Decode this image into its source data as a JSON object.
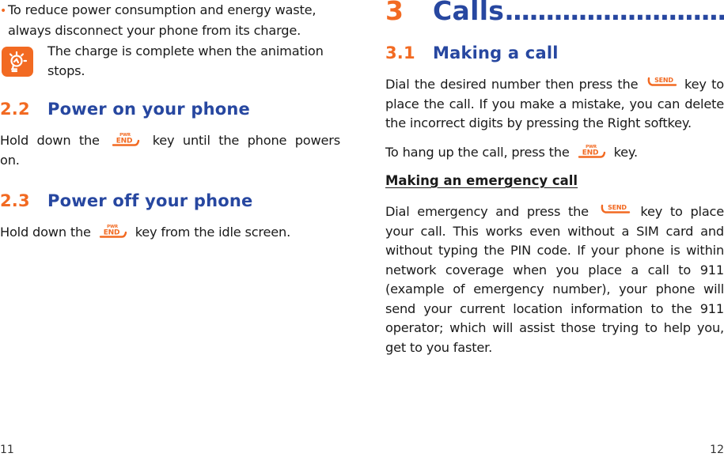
{
  "left_page": {
    "bullet": {
      "line1": "To reduce power consumption and energy waste,",
      "line2": "always disconnect your phone from its charge."
    },
    "tip": {
      "icon": "lightbulb-icon",
      "line1": "The charge is complete when the animation",
      "line2": "stops."
    },
    "section_2_2": {
      "number": "2.2",
      "title": "Power on your phone",
      "text_before": "Hold down the",
      "key": {
        "label": "END",
        "superscript": "PWR",
        "icon": "end-power-key-icon"
      },
      "text_after": "key until the phone powers on."
    },
    "section_2_3": {
      "number": "2.3",
      "title": "Power off your phone",
      "text_before": "Hold down the",
      "key": {
        "label": "END",
        "superscript": "PWR",
        "icon": "end-power-key-icon"
      },
      "text_after": "key from the idle screen."
    },
    "page_number": "11"
  },
  "right_page": {
    "chapter": {
      "number": "3",
      "title": "Calls",
      "leader": "..............................."
    },
    "section_3_1": {
      "number": "3.1",
      "title": "Making a call",
      "para1_before": "Dial the desired number then press the",
      "send_key": {
        "label": "SEND",
        "icon": "send-key-icon"
      },
      "para1_after": "key to place the call. If you make a mistake, you can delete the incorrect digits by pressing the Right softkey.",
      "para2_before": "To hang up the call, press the",
      "end_key": {
        "label": "END",
        "superscript": "PWR",
        "icon": "end-power-key-icon"
      },
      "para2_after": "key."
    },
    "emergency": {
      "heading": "Making an emergency call",
      "text_before": "Dial emergency and press the",
      "send_key": {
        "label": "SEND",
        "icon": "send-key-icon"
      },
      "text_after": "key to place your call. This works even without a SIM card and without typing the PIN code. If your phone is within network coverage when you place a call to 911 (example of emergency number), your phone will send your current location information to the 911 operator; which will assist those trying to help you, get to you faster."
    },
    "page_number": "12"
  },
  "colors": {
    "accent_orange": "#f26a22",
    "heading_blue": "#2747a0",
    "body_text": "#1a1a1a"
  }
}
